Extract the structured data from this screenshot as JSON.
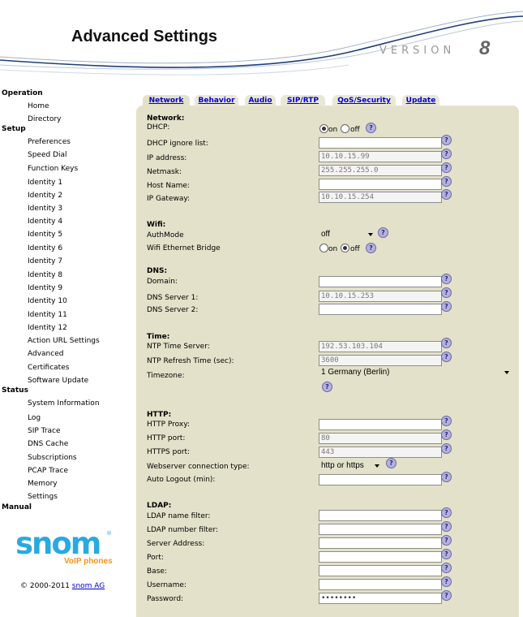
{
  "header": {
    "title": "Advanced Settings",
    "version_text": "VERSION",
    "version_number": "8"
  },
  "sidebar": {
    "operation": "Operation",
    "home": "Home",
    "directory": "Directory",
    "setup": "Setup",
    "preferences": "Preferences",
    "speed_dial": "Speed Dial",
    "function_keys": "Function Keys",
    "identity_1": "Identity 1",
    "identity_2": "Identity 2",
    "identity_3": "Identity 3",
    "identity_4": "Identity 4",
    "identity_5": "Identity 5",
    "identity_6": "Identity 6",
    "identity_7": "Identity 7",
    "identity_8": "Identity 8",
    "identity_9": "Identity 9",
    "identity_10": "Identity 10",
    "identity_11": "Identity 11",
    "identity_12": "Identity 12",
    "action_url": "Action URL Settings",
    "advanced": "Advanced",
    "certificates": "Certificates",
    "software_update": "Software Update",
    "status": "Status",
    "system_information": "System Information",
    "log": "Log",
    "sip_trace": "SIP Trace",
    "dns_cache": "DNS Cache",
    "subscriptions": "Subscriptions",
    "pcap_trace": "PCAP Trace",
    "memory": "Memory",
    "settings": "Settings",
    "manual": "Manual"
  },
  "logo": {
    "word": "snom",
    "tagline": "VoIP phones",
    "reg": "®"
  },
  "footer": {
    "copyright": "© 2000-2011 ",
    "company": "snom AG"
  },
  "tabs": {
    "network": "Network",
    "behavior": "Behavior",
    "audio": "Audio",
    "sip_rtp": "SIP/RTP",
    "qos": "QoS/Security",
    "update": "Update"
  },
  "help_glyph": "?",
  "network": {
    "section": "Network:",
    "dhcp": "DHCP:",
    "dhcp_on": "on",
    "dhcp_off": "off",
    "dhcp_ignore": "DHCP ignore list:",
    "dhcp_ignore_value": "",
    "ip": "IP address:",
    "ip_value": "10.10.15.99",
    "netmask": "Netmask:",
    "netmask_value": "255.255.255.0",
    "host": "Host Name:",
    "host_value": "",
    "gateway": "IP Gateway:",
    "gateway_value": "10.10.15.254"
  },
  "wifi": {
    "section": "Wifi:",
    "authmode": "AuthMode",
    "authmode_value": "off",
    "bridge": "Wifi Ethernet Bridge",
    "bridge_on": "on",
    "bridge_off": "off"
  },
  "dns": {
    "section": "DNS:",
    "domain": "Domain:",
    "domain_value": "",
    "server1": "DNS Server 1:",
    "server1_value": "10.10.15.253",
    "server2": "DNS Server 2:",
    "server2_value": ""
  },
  "time": {
    "section": "Time:",
    "ntp": "NTP Time Server:",
    "ntp_value": "192.53.103.104",
    "refresh": "NTP Refresh Time (sec):",
    "refresh_value": "3600",
    "timezone": "Timezone:",
    "timezone_value": "1 Germany (Berlin)"
  },
  "http": {
    "section": "HTTP:",
    "proxy": "HTTP Proxy:",
    "proxy_value": "",
    "port": "HTTP port:",
    "port_value": "80",
    "https": "HTTPS port:",
    "https_value": "443",
    "conn": "Webserver connection type:",
    "conn_value": "http or https",
    "logout": "Auto Logout (min):",
    "logout_value": ""
  },
  "ldap": {
    "section": "LDAP:",
    "name_filter": "LDAP name filter:",
    "number_filter": "LDAP number filter:",
    "server": "Server Address:",
    "port": "Port:",
    "base": "Base:",
    "username": "Username:",
    "password": "Password:",
    "password_value": "••••••••"
  }
}
